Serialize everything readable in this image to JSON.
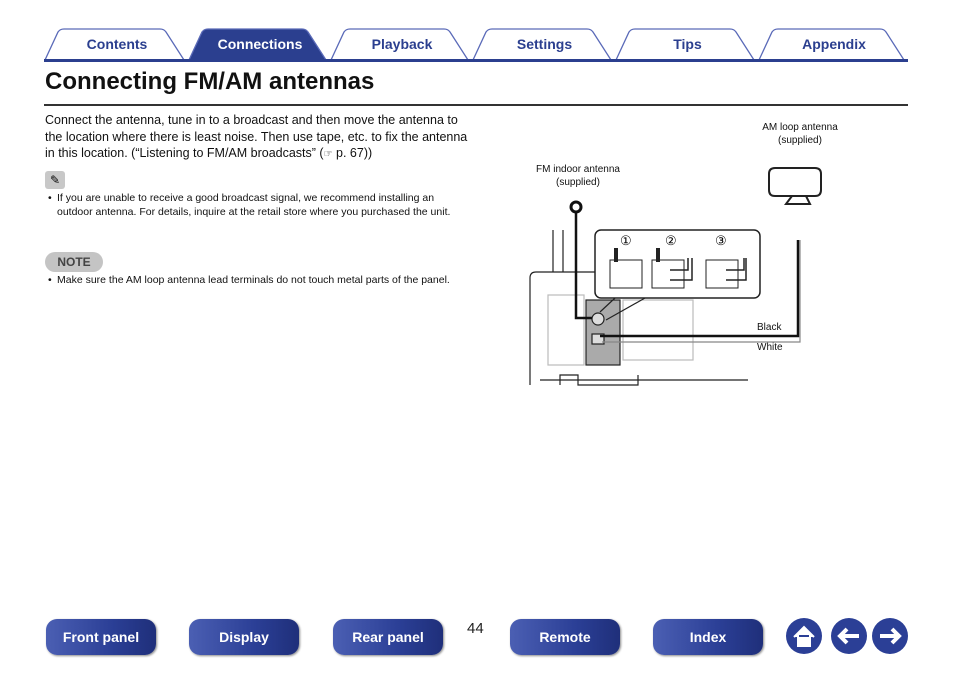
{
  "tabs": [
    {
      "label": "Contents",
      "active": false
    },
    {
      "label": "Connections",
      "active": true
    },
    {
      "label": "Playback",
      "active": false
    },
    {
      "label": "Settings",
      "active": false
    },
    {
      "label": "Tips",
      "active": false
    },
    {
      "label": "Appendix",
      "active": false
    }
  ],
  "title": "Connecting FM/AM antennas",
  "intro": "Connect the antenna, tune in to a broadcast and then move the antenna to the location where there is least noise. Then use tape, etc. to fix the antenna in this location. (“Listening to FM/AM broadcasts” (",
  "intro_ref": "p. 67))",
  "memo_icon": "pencil-icon",
  "memo_items": [
    "If you are unable to receive a good broadcast signal, we recommend installing an outdoor antenna. For details, inquire at the retail store where you purchased the unit."
  ],
  "note_label": "NOTE",
  "note_items": [
    "Make sure the AM loop antenna lead terminals do not touch metal parts of the panel."
  ],
  "diagram": {
    "fm_label": "FM indoor antenna",
    "fm_sub": "(supplied)",
    "am_label": "AM loop antenna",
    "am_sub": "(supplied)",
    "black": "Black",
    "white": "White",
    "steps": [
      "①",
      "②",
      "③"
    ]
  },
  "footer": {
    "buttons": [
      "Front panel",
      "Display",
      "Rear panel",
      "Remote",
      "Index"
    ],
    "page": "44",
    "icons": [
      "home-icon",
      "arrow-left-icon",
      "arrow-right-icon"
    ]
  },
  "colors": {
    "accent": "#2b3f8f"
  }
}
